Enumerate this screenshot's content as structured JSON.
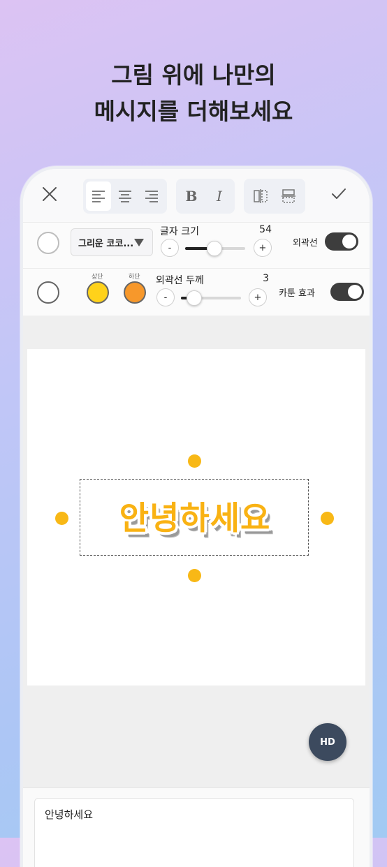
{
  "headline": {
    "line1": "그림 위에 나만의",
    "line2": "메시지를 더해보세요"
  },
  "toolbar": {
    "close_icon": "close-icon",
    "confirm_icon": "check-icon",
    "align_buttons": [
      "align-left-icon",
      "align-center-icon",
      "align-right-icon"
    ],
    "align_selected": "align-left",
    "bold_label": "B",
    "italic_label": "I",
    "flip_buttons": [
      "flip-horizontal-icon",
      "flip-vertical-icon"
    ]
  },
  "font_row": {
    "font_name": "그리운 코코...",
    "font_size_label": "글자 크기",
    "font_size_value": "54",
    "font_size_fraction": 0.5,
    "minus": "-",
    "plus": "+",
    "outline_label": "외곽선",
    "outline_on": true
  },
  "color_row": {
    "top_label": "상단",
    "bottom_label": "하단",
    "top_color": "#ffd21a",
    "bottom_color": "#f7982b",
    "stroke_label": "외곽선 두께",
    "stroke_value": "3",
    "stroke_fraction": 0.2,
    "minus": "-",
    "plus": "+",
    "cartoon_label": "카툰 효과",
    "cartoon_on": true
  },
  "canvas": {
    "sticker_text": "안녕하세요",
    "handle_color": "#f8b816"
  },
  "hd_button": "HD",
  "text_input": {
    "value": "안녕하세요"
  }
}
